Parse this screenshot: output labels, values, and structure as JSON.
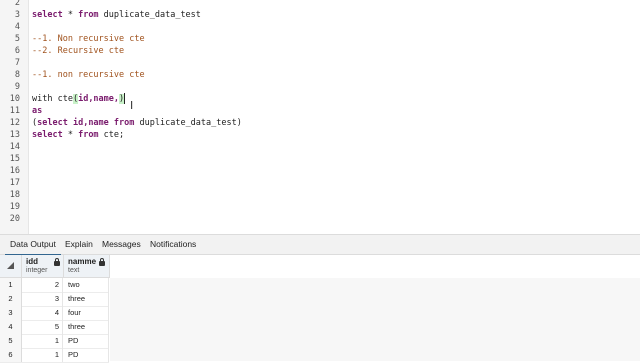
{
  "editor": {
    "line_numbers": [
      "2",
      "3",
      "4",
      "5",
      "6",
      "7",
      "8",
      "9",
      "10",
      "11",
      "12",
      "13",
      "14",
      "15",
      "16",
      "17",
      "18",
      "19",
      "20"
    ],
    "lines": {
      "l3_kw1": "select",
      "l3_rest": " * ",
      "l3_kw2": "from",
      "l3_tail": " duplicate_data_test",
      "l5": "--1. Non recursive cte",
      "l6": "--2. Recursive cte",
      "l8": "--1. non recursive cte",
      "l10_a": "with cte",
      "l10_open": "(",
      "l10_args": "id,name,",
      "l10_close": ")",
      "l11": "as",
      "l12_open": "(",
      "l12_kw1": "select",
      "l12_mid": " id,name ",
      "l12_kw2": "from",
      "l12_tail": " duplicate_data_test)",
      "l13_kw1": "select",
      "l13_mid": " * ",
      "l13_kw2": "from",
      "l13_tail": " cte;"
    },
    "cursor_icon": "I"
  },
  "output": {
    "tabs": [
      "Data Output",
      "Explain",
      "Messages",
      "Notifications"
    ],
    "columns": [
      {
        "name": "idd",
        "type": "integer"
      },
      {
        "name": "namme",
        "type": "text"
      }
    ],
    "rows": [
      {
        "n": "1",
        "id": "2",
        "name": "two"
      },
      {
        "n": "2",
        "id": "3",
        "name": "three"
      },
      {
        "n": "3",
        "id": "4",
        "name": "four"
      },
      {
        "n": "4",
        "id": "5",
        "name": "three"
      },
      {
        "n": "5",
        "id": "1",
        "name": "PD"
      },
      {
        "n": "6",
        "id": "1",
        "name": "PD"
      }
    ]
  }
}
